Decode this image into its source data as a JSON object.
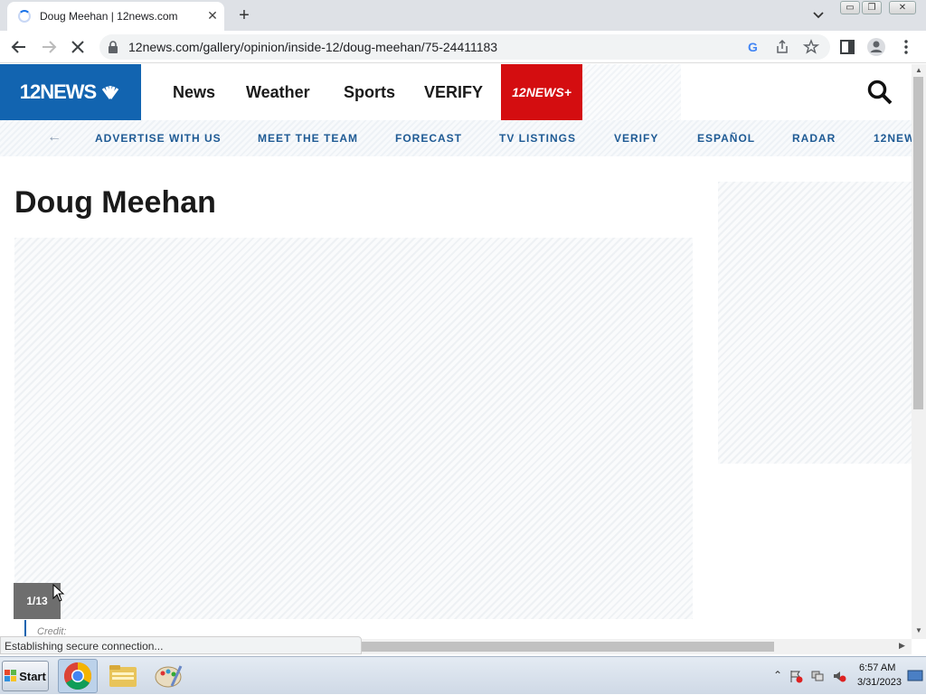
{
  "browser": {
    "tab_title": "Doug Meehan | 12news.com",
    "tab_close": "✕",
    "new_tab": "+",
    "url": "12news.com/gallery/opinion/inside-12/doug-meehan/75-24411183",
    "status_text": "Establishing secure connection...",
    "window_min": "▭",
    "window_restore": "❐",
    "window_close": "✕"
  },
  "site": {
    "logo_text": "12NEWS",
    "plus_text": "12NEWS+",
    "nav": [
      "News",
      "Weather",
      "Sports",
      "VERIFY"
    ],
    "subnav": [
      "ADVERTISE WITH US",
      "MEET THE TEAM",
      "FORECAST",
      "TV LISTINGS",
      "VERIFY",
      "ESPAÑOL",
      "RADAR",
      "12NEW"
    ],
    "subnav_back": "←"
  },
  "content": {
    "title": "Doug Meehan",
    "counter": "1/13",
    "credit_label": "Credit:"
  },
  "taskbar": {
    "start_label": "Start",
    "time": "6:57 AM",
    "date": "3/31/2023"
  },
  "colors": {
    "brand_blue": "#1264b0",
    "plus_red": "#d40d10",
    "subnav_text": "#1e5a94"
  }
}
